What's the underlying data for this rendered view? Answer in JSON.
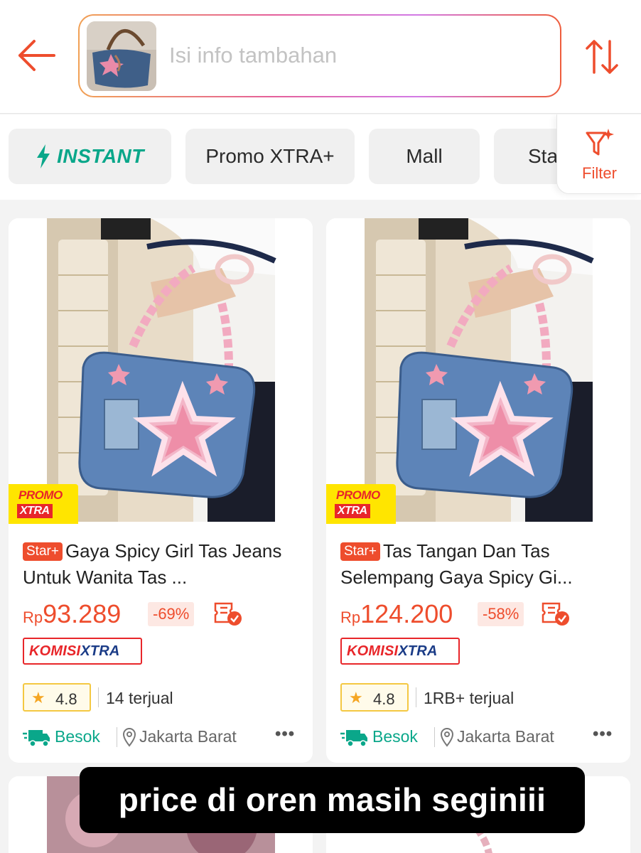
{
  "header": {
    "search_placeholder": "Isi info tambahan",
    "accent_color": "#ee4d2d"
  },
  "chips": {
    "instant": "INSTANT",
    "promo": "Promo XTRA+",
    "mall": "Mall",
    "star": "Sta",
    "filter": "Filter"
  },
  "products": [
    {
      "badge": "Star+",
      "title": "Gaya Spicy Girl Tas Jeans Untuk Wanita Tas ...",
      "currency": "Rp",
      "price": "93.289",
      "discount": "-69%",
      "promo_line1": "PROMO",
      "promo_line2": "XTRA",
      "komisi1": "KOMISI",
      "komisi2": "XTRA",
      "rating": "4.8",
      "sold": "14 terjual",
      "shipping": "Besok",
      "location": "Jakarta Barat",
      "more": "•••"
    },
    {
      "badge": "Star+",
      "title": "Tas Tangan Dan Tas Selempang Gaya Spicy Gi...",
      "currency": "Rp",
      "price": "124.200",
      "discount": "-58%",
      "promo_line1": "PROMO",
      "promo_line2": "XTRA",
      "komisi1": "KOMISI",
      "komisi2": "XTRA",
      "rating": "4.8",
      "sold": "1RB+ terjual",
      "shipping": "Besok",
      "location": "Jakarta Barat",
      "more": "•••"
    }
  ],
  "caption": "price di oren masih seginiii"
}
